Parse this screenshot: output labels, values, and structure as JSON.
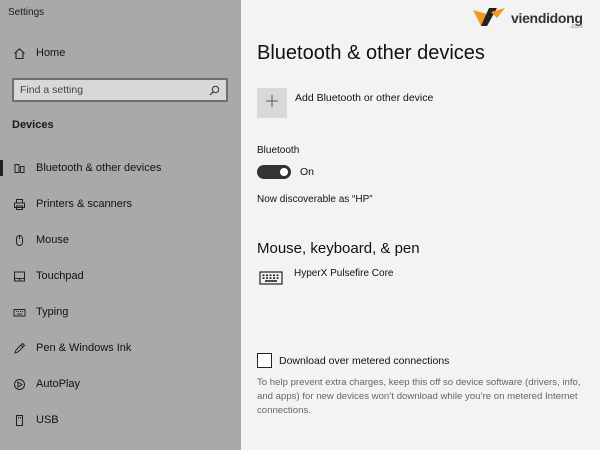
{
  "window": {
    "title": "Settings"
  },
  "sidebar": {
    "home_label": "Home",
    "search_placeholder": "Find a setting",
    "section_label": "Devices",
    "items": [
      {
        "label": "Bluetooth & other devices",
        "icon": "bluetooth-icon",
        "active": true
      },
      {
        "label": "Printers & scanners",
        "icon": "printer-icon",
        "active": false
      },
      {
        "label": "Mouse",
        "icon": "mouse-icon",
        "active": false
      },
      {
        "label": "Touchpad",
        "icon": "touchpad-icon",
        "active": false
      },
      {
        "label": "Typing",
        "icon": "keyboard-icon",
        "active": false
      },
      {
        "label": "Pen & Windows Ink",
        "icon": "pen-icon",
        "active": false
      },
      {
        "label": "AutoPlay",
        "icon": "autoplay-icon",
        "active": false
      },
      {
        "label": "USB",
        "icon": "usb-icon",
        "active": false
      }
    ]
  },
  "main": {
    "title": "Bluetooth & other devices",
    "add_device_label": "Add Bluetooth or other device",
    "bluetooth_label": "Bluetooth",
    "bluetooth_state": "On",
    "discoverable_text": "Now discoverable as “HP”",
    "section_heading": "Mouse, keyboard, & pen",
    "devices": [
      {
        "name": "HyperX Pulsefire Core",
        "icon": "keyboard-icon"
      }
    ],
    "metered_label": "Download over metered connections",
    "metered_checked": false,
    "help_text": "To help prevent extra charges, keep this off so device software (drivers, info, and apps) for new devices won’t download while you’re on metered Internet connections."
  },
  "watermark": {
    "word": "viendidong",
    "sub": ".com"
  },
  "colors": {
    "sidebar_bg": "#a9a9a9",
    "content_bg": "#f3f3f3",
    "toggle_on": "#333333",
    "logo_orange": "#f39a1e"
  }
}
